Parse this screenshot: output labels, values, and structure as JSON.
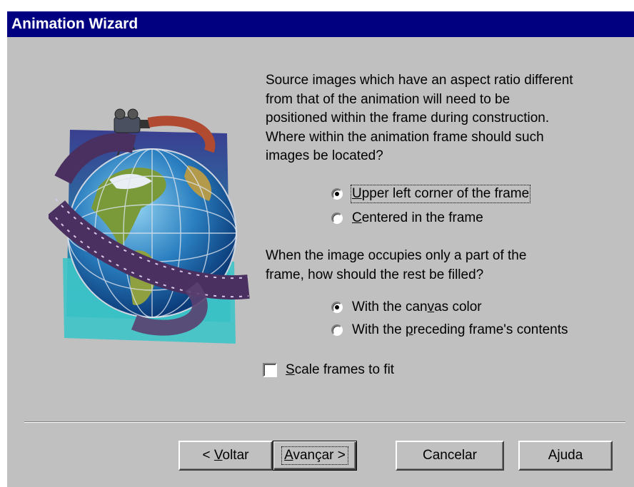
{
  "window": {
    "title": "Animation Wizard"
  },
  "prompt1": {
    "lines": [
      "Source images which have an aspect ratio different",
      "from that of the animation will need to be",
      "positioned within the frame during construction.",
      "Where within the animation frame should such",
      "images be located?"
    ]
  },
  "position_options": [
    {
      "pre": "",
      "key": "U",
      "post": "pper left corner of the frame",
      "selected": true
    },
    {
      "pre": "",
      "key": "C",
      "post": "entered in the frame",
      "selected": false
    }
  ],
  "prompt2": {
    "lines": [
      "When the image occupies only a part of the",
      "frame, how should the rest be filled?"
    ]
  },
  "fill_options": [
    {
      "pre": "With the can",
      "key": "v",
      "post": "as color",
      "selected": true
    },
    {
      "pre": "With the ",
      "key": "p",
      "post": "receding frame's contents",
      "selected": false
    }
  ],
  "scale_checkbox": {
    "pre": "",
    "key": "S",
    "post": "cale frames to fit",
    "checked": false
  },
  "buttons": {
    "back": {
      "pre": "< ",
      "key": "V",
      "post": "oltar"
    },
    "next": {
      "pre": "",
      "key": "A",
      "post": "vançar >"
    },
    "cancel": "Cancelar",
    "help": "Ajuda"
  },
  "colors": {
    "titlebar": "#000080",
    "dialog": "#c0c0c0"
  },
  "icons": {
    "illustration": "globe-with-film-strip-and-camera"
  }
}
